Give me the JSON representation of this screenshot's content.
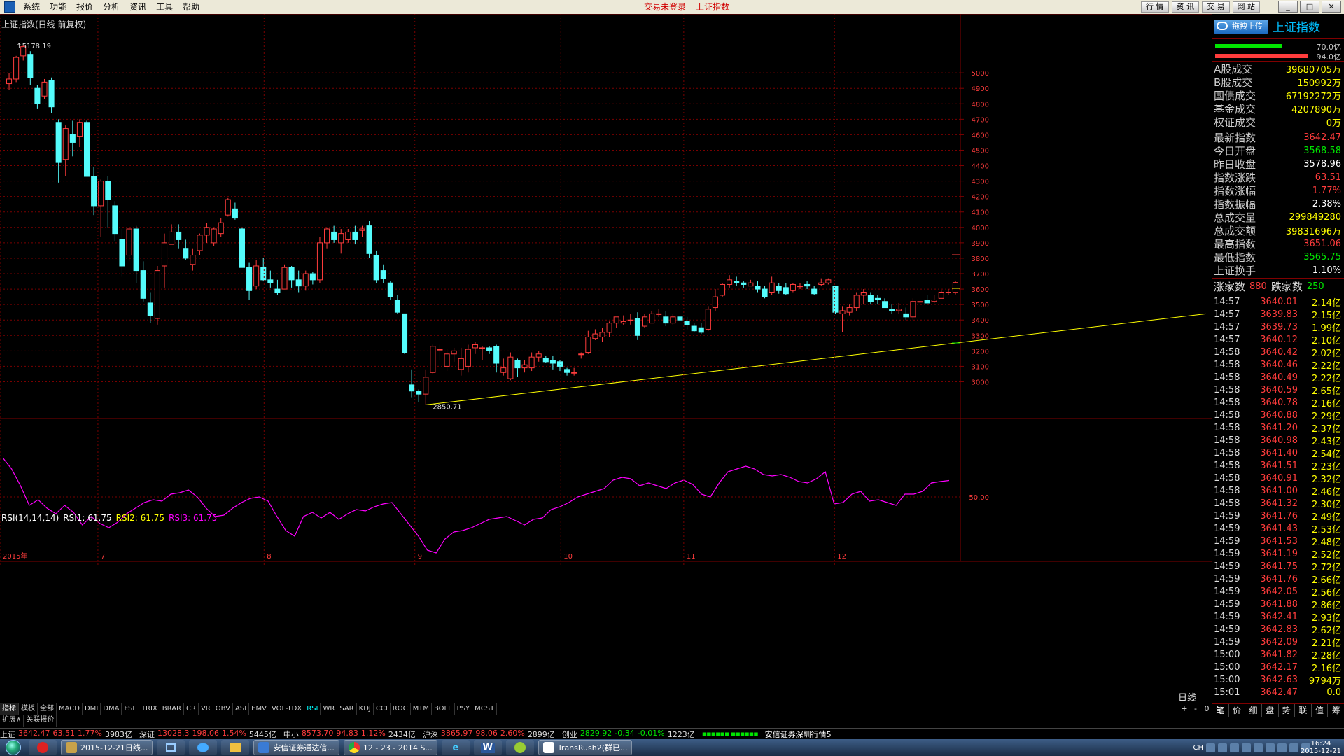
{
  "menu": {
    "items": [
      "系统",
      "功能",
      "报价",
      "分析",
      "资讯",
      "工具",
      "帮助"
    ],
    "status_login": "交易未登录",
    "status_index": "上证指数",
    "top_buttons": [
      "行 情",
      "资 讯",
      "交 易",
      "网 站"
    ]
  },
  "chart": {
    "title": "上证指数(日线 前复权)",
    "high_label": "5178.19",
    "low_label": "2850.71",
    "rsi_label": "RSI(14,14,14)",
    "rsi1": "RSI1: 61.75",
    "rsi2": "RSI2: 61.75",
    "rsi3": "RSI3: 61.75",
    "rsi_axis_label": "50.00",
    "period": "日线",
    "year_label": "2015年"
  },
  "chart_data": {
    "type": "candlestick",
    "title": "上证指数(日线 前复权)",
    "x_tick_labels": [
      "2015年",
      "7",
      "8",
      "9",
      "10",
      "11",
      "12"
    ],
    "y_tick_labels": [
      "3000",
      "3100",
      "3200",
      "3300",
      "3400",
      "3500",
      "3600",
      "3700",
      "3800",
      "3900",
      "4000",
      "4100",
      "4200",
      "4300",
      "4400",
      "4500",
      "4600",
      "4700",
      "4800",
      "4900",
      "5000"
    ],
    "ylim": [
      2830,
      5200
    ],
    "annotations": [
      {
        "label": "5178.19",
        "value": 5178.19
      },
      {
        "label": "2850.71",
        "value": 2850.71
      }
    ],
    "trendline": {
      "from": 2850.71,
      "to": 3440,
      "color": "#ffff00"
    },
    "candles": [
      [
        4930,
        4960,
        5000,
        4890
      ],
      [
        4960,
        5100,
        5110,
        4940
      ],
      [
        5110,
        5170,
        5178.19,
        5080
      ],
      [
        5120,
        4970,
        5140,
        4920
      ],
      [
        4900,
        4800,
        4920,
        4770
      ],
      [
        4850,
        4940,
        4960,
        4830
      ],
      [
        4950,
        4780,
        4970,
        4740
      ],
      [
        4680,
        4420,
        4700,
        4290
      ],
      [
        4440,
        4640,
        4660,
        4330
      ],
      [
        4600,
        4550,
        4690,
        4460
      ],
      [
        4590,
        4680,
        4700,
        4520
      ],
      [
        4680,
        4330,
        4690,
        4330
      ],
      [
        4330,
        4140,
        4390,
        4080
      ],
      [
        4140,
        4300,
        4310,
        3940
      ],
      [
        4300,
        4180,
        4330,
        4000
      ],
      [
        4140,
        3960,
        4170,
        3910
      ],
      [
        3920,
        3750,
        3990,
        3680
      ],
      [
        3820,
        3990,
        4000,
        3780
      ],
      [
        3990,
        3720,
        4010,
        3640
      ],
      [
        3720,
        3540,
        3780,
        3520
      ],
      [
        3510,
        3430,
        3580,
        3380
      ],
      [
        3410,
        3720,
        3750,
        3370
      ],
      [
        3750,
        3900,
        3960,
        3610
      ],
      [
        3890,
        3970,
        4020,
        3890
      ],
      [
        3970,
        3920,
        4020,
        3860
      ],
      [
        3860,
        3800,
        3920,
        3790
      ],
      [
        3760,
        3820,
        3860,
        3720
      ],
      [
        3850,
        3950,
        3960,
        3820
      ],
      [
        3950,
        4000,
        4030,
        3900
      ],
      [
        3900,
        3990,
        4000,
        3880
      ],
      [
        3960,
        4030,
        4060,
        3940
      ],
      [
        4080,
        4180,
        4190,
        4070
      ],
      [
        4120,
        4060,
        4160,
        4050
      ],
      [
        3990,
        3740,
        4000,
        3740
      ],
      [
        3740,
        3590,
        3770,
        3530
      ],
      [
        3620,
        3750,
        3790,
        3600
      ],
      [
        3740,
        3660,
        3800,
        3650
      ],
      [
        3660,
        3640,
        3720,
        3610
      ],
      [
        3600,
        3580,
        3660,
        3560
      ],
      [
        3600,
        3740,
        3760,
        3600
      ],
      [
        3740,
        3660,
        3750,
        3610
      ],
      [
        3660,
        3620,
        3720,
        3580
      ],
      [
        3620,
        3700,
        3720,
        3590
      ],
      [
        3700,
        3660,
        3710,
        3630
      ],
      [
        3660,
        3900,
        3940,
        3640
      ],
      [
        3900,
        3990,
        4000,
        3860
      ],
      [
        3970,
        3920,
        4010,
        3900
      ],
      [
        3900,
        3960,
        3990,
        3830
      ],
      [
        3920,
        3970,
        3990,
        3900
      ],
      [
        3970,
        3920,
        4010,
        3890
      ],
      [
        3980,
        3990,
        4010,
        3940
      ],
      [
        4010,
        3830,
        4040,
        3800
      ],
      [
        3820,
        3660,
        3850,
        3640
      ],
      [
        3720,
        3670,
        3760,
        3640
      ],
      [
        3640,
        3550,
        3650,
        3530
      ],
      [
        3530,
        3450,
        3560,
        3440
      ],
      [
        3440,
        3190,
        3440,
        3180
      ],
      [
        2980,
        2940,
        3080,
        2900
      ],
      [
        2940,
        2920,
        2950,
        2870
      ],
      [
        2920,
        3030,
        3080,
        2850.71
      ],
      [
        3060,
        3230,
        3240,
        3050
      ],
      [
        3210,
        3210,
        3240,
        3140
      ],
      [
        3100,
        3180,
        3210,
        3070
      ],
      [
        3180,
        3200,
        3220,
        3130
      ],
      [
        3080,
        3150,
        3220,
        3040
      ],
      [
        3100,
        3210,
        3240,
        3060
      ],
      [
        3220,
        3240,
        3260,
        3180
      ],
      [
        3220,
        3220,
        3230,
        3140
      ],
      [
        3220,
        3200,
        3230,
        3180
      ],
      [
        3230,
        3120,
        3240,
        3060
      ],
      [
        3060,
        3090,
        3150,
        3040
      ],
      [
        3020,
        3160,
        3190,
        3010
      ],
      [
        3140,
        3090,
        3150,
        3030
      ],
      [
        3090,
        3110,
        3140,
        3060
      ],
      [
        3090,
        3160,
        3190,
        3070
      ],
      [
        3160,
        3180,
        3200,
        3130
      ],
      [
        3150,
        3130,
        3170,
        3120
      ],
      [
        3140,
        3120,
        3170,
        3080
      ],
      [
        3130,
        3100,
        3140,
        3070
      ],
      [
        3080,
        3060,
        3090,
        3040
      ],
      [
        3060,
        3060,
        3090,
        3040
      ],
      [
        3180,
        3180,
        3190,
        3150
      ],
      [
        3190,
        3290,
        3330,
        3180
      ],
      [
        3280,
        3310,
        3340,
        3270
      ],
      [
        3290,
        3320,
        3350,
        3260
      ],
      [
        3320,
        3380,
        3390,
        3290
      ],
      [
        3380,
        3420,
        3420,
        3350
      ],
      [
        3380,
        3390,
        3430,
        3370
      ],
      [
        3400,
        3400,
        3440,
        3370
      ],
      [
        3410,
        3300,
        3450,
        3270
      ],
      [
        3360,
        3420,
        3440,
        3350
      ],
      [
        3380,
        3440,
        3460,
        3380
      ],
      [
        3440,
        3440,
        3470,
        3420
      ],
      [
        3420,
        3380,
        3460,
        3360
      ],
      [
        3380,
        3420,
        3440,
        3370
      ],
      [
        3420,
        3400,
        3450,
        3380
      ],
      [
        3390,
        3370,
        3420,
        3340
      ],
      [
        3360,
        3330,
        3380,
        3320
      ],
      [
        3350,
        3320,
        3380,
        3310
      ],
      [
        3340,
        3470,
        3490,
        3330
      ],
      [
        3480,
        3550,
        3600,
        3460
      ],
      [
        3560,
        3630,
        3640,
        3550
      ],
      [
        3630,
        3660,
        3690,
        3610
      ],
      [
        3650,
        3640,
        3680,
        3620
      ],
      [
        3640,
        3630,
        3650,
        3610
      ],
      [
        3620,
        3640,
        3660,
        3620
      ],
      [
        3620,
        3600,
        3650,
        3580
      ],
      [
        3600,
        3550,
        3620,
        3540
      ],
      [
        3580,
        3640,
        3680,
        3560
      ],
      [
        3620,
        3590,
        3640,
        3570
      ],
      [
        3610,
        3570,
        3640,
        3560
      ],
      [
        3590,
        3630,
        3640,
        3580
      ],
      [
        3620,
        3620,
        3640,
        3600
      ],
      [
        3630,
        3620,
        3650,
        3600
      ],
      [
        3600,
        3570,
        3620,
        3560
      ],
      [
        3630,
        3640,
        3670,
        3620
      ],
      [
        3640,
        3660,
        3670,
        3630
      ],
      [
        3620,
        3450,
        3620,
        3440
      ],
      [
        3440,
        3460,
        3490,
        3320
      ],
      [
        3450,
        3480,
        3500,
        3430
      ],
      [
        3480,
        3560,
        3580,
        3460
      ],
      [
        3560,
        3580,
        3600,
        3500
      ],
      [
        3560,
        3520,
        3580,
        3500
      ],
      [
        3540,
        3530,
        3560,
        3500
      ],
      [
        3520,
        3480,
        3540,
        3480
      ],
      [
        3470,
        3460,
        3500,
        3440
      ],
      [
        3460,
        3470,
        3510,
        3440
      ],
      [
        3440,
        3420,
        3480,
        3400
      ],
      [
        3420,
        3520,
        3540,
        3400
      ],
      [
        3520,
        3520,
        3540,
        3500
      ],
      [
        3530,
        3510,
        3560,
        3510
      ],
      [
        3520,
        3530,
        3560,
        3510
      ],
      [
        3540,
        3580,
        3590,
        3540
      ],
      [
        3580,
        3580,
        3600,
        3560
      ],
      [
        3578.96,
        3642.47,
        3651.06,
        3565.75
      ]
    ],
    "rsi_values": [
      78,
      70,
      58,
      44,
      48,
      42,
      38,
      44,
      39,
      30,
      36,
      31,
      28,
      32,
      38,
      42,
      46,
      48,
      47,
      52,
      53,
      55,
      50,
      42,
      36,
      37,
      42,
      46,
      49,
      50,
      47,
      36,
      26,
      22,
      36,
      39,
      35,
      39,
      34,
      38,
      41,
      40,
      43,
      45,
      46,
      38,
      30,
      22,
      12,
      10,
      20,
      25,
      26,
      28,
      31,
      34,
      35,
      36,
      33,
      30,
      34,
      35,
      41,
      43,
      46,
      50,
      52,
      54,
      56,
      62,
      64,
      63,
      58,
      60,
      58,
      56,
      60,
      62,
      59,
      52,
      50,
      60,
      68,
      70,
      72,
      70,
      66,
      65,
      66,
      64,
      61,
      60,
      63,
      68,
      45,
      46,
      52,
      54,
      47,
      48,
      46,
      44,
      52,
      52,
      54,
      60,
      61,
      61.75
    ]
  },
  "right_panel": {
    "drag_upload": "拖拽上传",
    "title": "上证指数",
    "bar_top_val": "70.0亿",
    "bar_bottom_val": "94.0亿",
    "trade_rows": [
      {
        "k": "A股成交",
        "v": "39680705万"
      },
      {
        "k": "B股成交",
        "v": "150992万"
      },
      {
        "k": "国债成交",
        "v": "67192272万"
      },
      {
        "k": "基金成交",
        "v": "4207890万"
      },
      {
        "k": "权证成交",
        "v": "0万"
      }
    ],
    "index_rows": [
      {
        "k": "最新指数",
        "v": "3642.47",
        "c": "up"
      },
      {
        "k": "今日开盘",
        "v": "3568.58",
        "c": "down"
      },
      {
        "k": "昨日收盘",
        "v": "3578.96",
        "c": "wht"
      },
      {
        "k": "指数涨跌",
        "v": "63.51",
        "c": "up"
      },
      {
        "k": "指数涨幅",
        "v": "1.77%",
        "c": "up"
      },
      {
        "k": "指数振幅",
        "v": "2.38%",
        "c": "wht"
      },
      {
        "k": "总成交量",
        "v": "299849280",
        "c": "yel"
      },
      {
        "k": "总成交额",
        "v": "39831696万",
        "c": "yel"
      },
      {
        "k": "最高指数",
        "v": "3651.06",
        "c": "up"
      },
      {
        "k": "最低指数",
        "v": "3565.75",
        "c": "down"
      },
      {
        "k": "上证换手",
        "v": "1.10%",
        "c": "wht"
      }
    ],
    "up_label": "涨家数",
    "up_count": "880",
    "down_label": "跌家数",
    "down_count": "250",
    "ticks": [
      {
        "t": "14:57",
        "p": "3640.01",
        "v": "2.14亿"
      },
      {
        "t": "14:57",
        "p": "3639.83",
        "v": "2.15亿"
      },
      {
        "t": "14:57",
        "p": "3639.73",
        "v": "1.99亿"
      },
      {
        "t": "14:57",
        "p": "3640.12",
        "v": "2.10亿"
      },
      {
        "t": "14:58",
        "p": "3640.42",
        "v": "2.02亿"
      },
      {
        "t": "14:58",
        "p": "3640.46",
        "v": "2.22亿"
      },
      {
        "t": "14:58",
        "p": "3640.49",
        "v": "2.22亿"
      },
      {
        "t": "14:58",
        "p": "3640.59",
        "v": "2.65亿"
      },
      {
        "t": "14:58",
        "p": "3640.78",
        "v": "2.16亿"
      },
      {
        "t": "14:58",
        "p": "3640.88",
        "v": "2.29亿"
      },
      {
        "t": "14:58",
        "p": "3641.20",
        "v": "2.37亿"
      },
      {
        "t": "14:58",
        "p": "3640.98",
        "v": "2.43亿"
      },
      {
        "t": "14:58",
        "p": "3641.40",
        "v": "2.54亿"
      },
      {
        "t": "14:58",
        "p": "3641.51",
        "v": "2.23亿"
      },
      {
        "t": "14:58",
        "p": "3640.91",
        "v": "2.32亿"
      },
      {
        "t": "14:58",
        "p": "3641.00",
        "v": "2.46亿"
      },
      {
        "t": "14:58",
        "p": "3641.32",
        "v": "2.30亿"
      },
      {
        "t": "14:59",
        "p": "3641.76",
        "v": "2.49亿"
      },
      {
        "t": "14:59",
        "p": "3641.43",
        "v": "2.53亿"
      },
      {
        "t": "14:59",
        "p": "3641.53",
        "v": "2.48亿"
      },
      {
        "t": "14:59",
        "p": "3641.19",
        "v": "2.52亿"
      },
      {
        "t": "14:59",
        "p": "3641.75",
        "v": "2.72亿"
      },
      {
        "t": "14:59",
        "p": "3641.76",
        "v": "2.66亿"
      },
      {
        "t": "14:59",
        "p": "3642.05",
        "v": "2.56亿"
      },
      {
        "t": "14:59",
        "p": "3641.88",
        "v": "2.86亿"
      },
      {
        "t": "14:59",
        "p": "3642.41",
        "v": "2.93亿"
      },
      {
        "t": "14:59",
        "p": "3642.83",
        "v": "2.62亿"
      },
      {
        "t": "14:59",
        "p": "3642.09",
        "v": "2.21亿"
      },
      {
        "t": "15:00",
        "p": "3641.82",
        "v": "2.28亿"
      },
      {
        "t": "15:00",
        "p": "3642.17",
        "v": "2.16亿"
      },
      {
        "t": "15:00",
        "p": "3642.63",
        "v": "9794万"
      },
      {
        "t": "15:01",
        "p": "3642.47",
        "v": "0.0"
      }
    ],
    "tabs": [
      "笔",
      "价",
      "细",
      "盘",
      "势",
      "联",
      "值",
      "筹"
    ]
  },
  "indicator_tabs": [
    "指标",
    "模板",
    "全部",
    "MACD",
    "DMI",
    "DMA",
    "FSL",
    "TRIX",
    "BRAR",
    "CR",
    "VR",
    "OBV",
    "ASI",
    "EMV",
    "VOL-TDX",
    "RSI",
    "WR",
    "SAR",
    "KDJ",
    "CCI",
    "ROC",
    "MTM",
    "BOLL",
    "PSY",
    "MCST"
  ],
  "indicator_tabs2": [
    "扩展∧",
    "关联报价"
  ],
  "zoom_controls": [
    "+",
    "-",
    "0"
  ],
  "ticker": {
    "sh_label": "上证",
    "sh_price": "3642.47",
    "sh_chg": "63.51",
    "sh_pct": "1.77%",
    "sh_amt": "3983亿",
    "sz_label": "深证",
    "sz_price": "13028.3",
    "sz_chg": "198.06",
    "sz_pct": "1.54%",
    "sz_amt": "5445亿",
    "zx_label": "中小",
    "zx_price": "8573.70",
    "zx_chg": "94.83",
    "zx_pct": "1.12%",
    "zx_amt": "2434亿",
    "hs_label": "沪深",
    "hs_price": "3865.97",
    "hs_chg": "98.06",
    "hs_pct": "2.60%",
    "hs_amt": "2899亿",
    "cy_label": "创业",
    "cy_price": "2829.92",
    "cy_chg": "-0.34",
    "cy_pct": "-0.01%",
    "cy_amt": "1223亿",
    "signal": "▪▪▪▪▪▪ ▪▪▪▪▪▪",
    "server": "安信证券深圳行情5"
  },
  "taskbar": {
    "tasks": [
      "2015-12-21日线...",
      "安信证券通达信...",
      "12 - 23 - 2014 S...",
      "TransRush2(群已..."
    ],
    "tray_lang": "CH",
    "time": "16:24",
    "date": "2015-12-21"
  }
}
